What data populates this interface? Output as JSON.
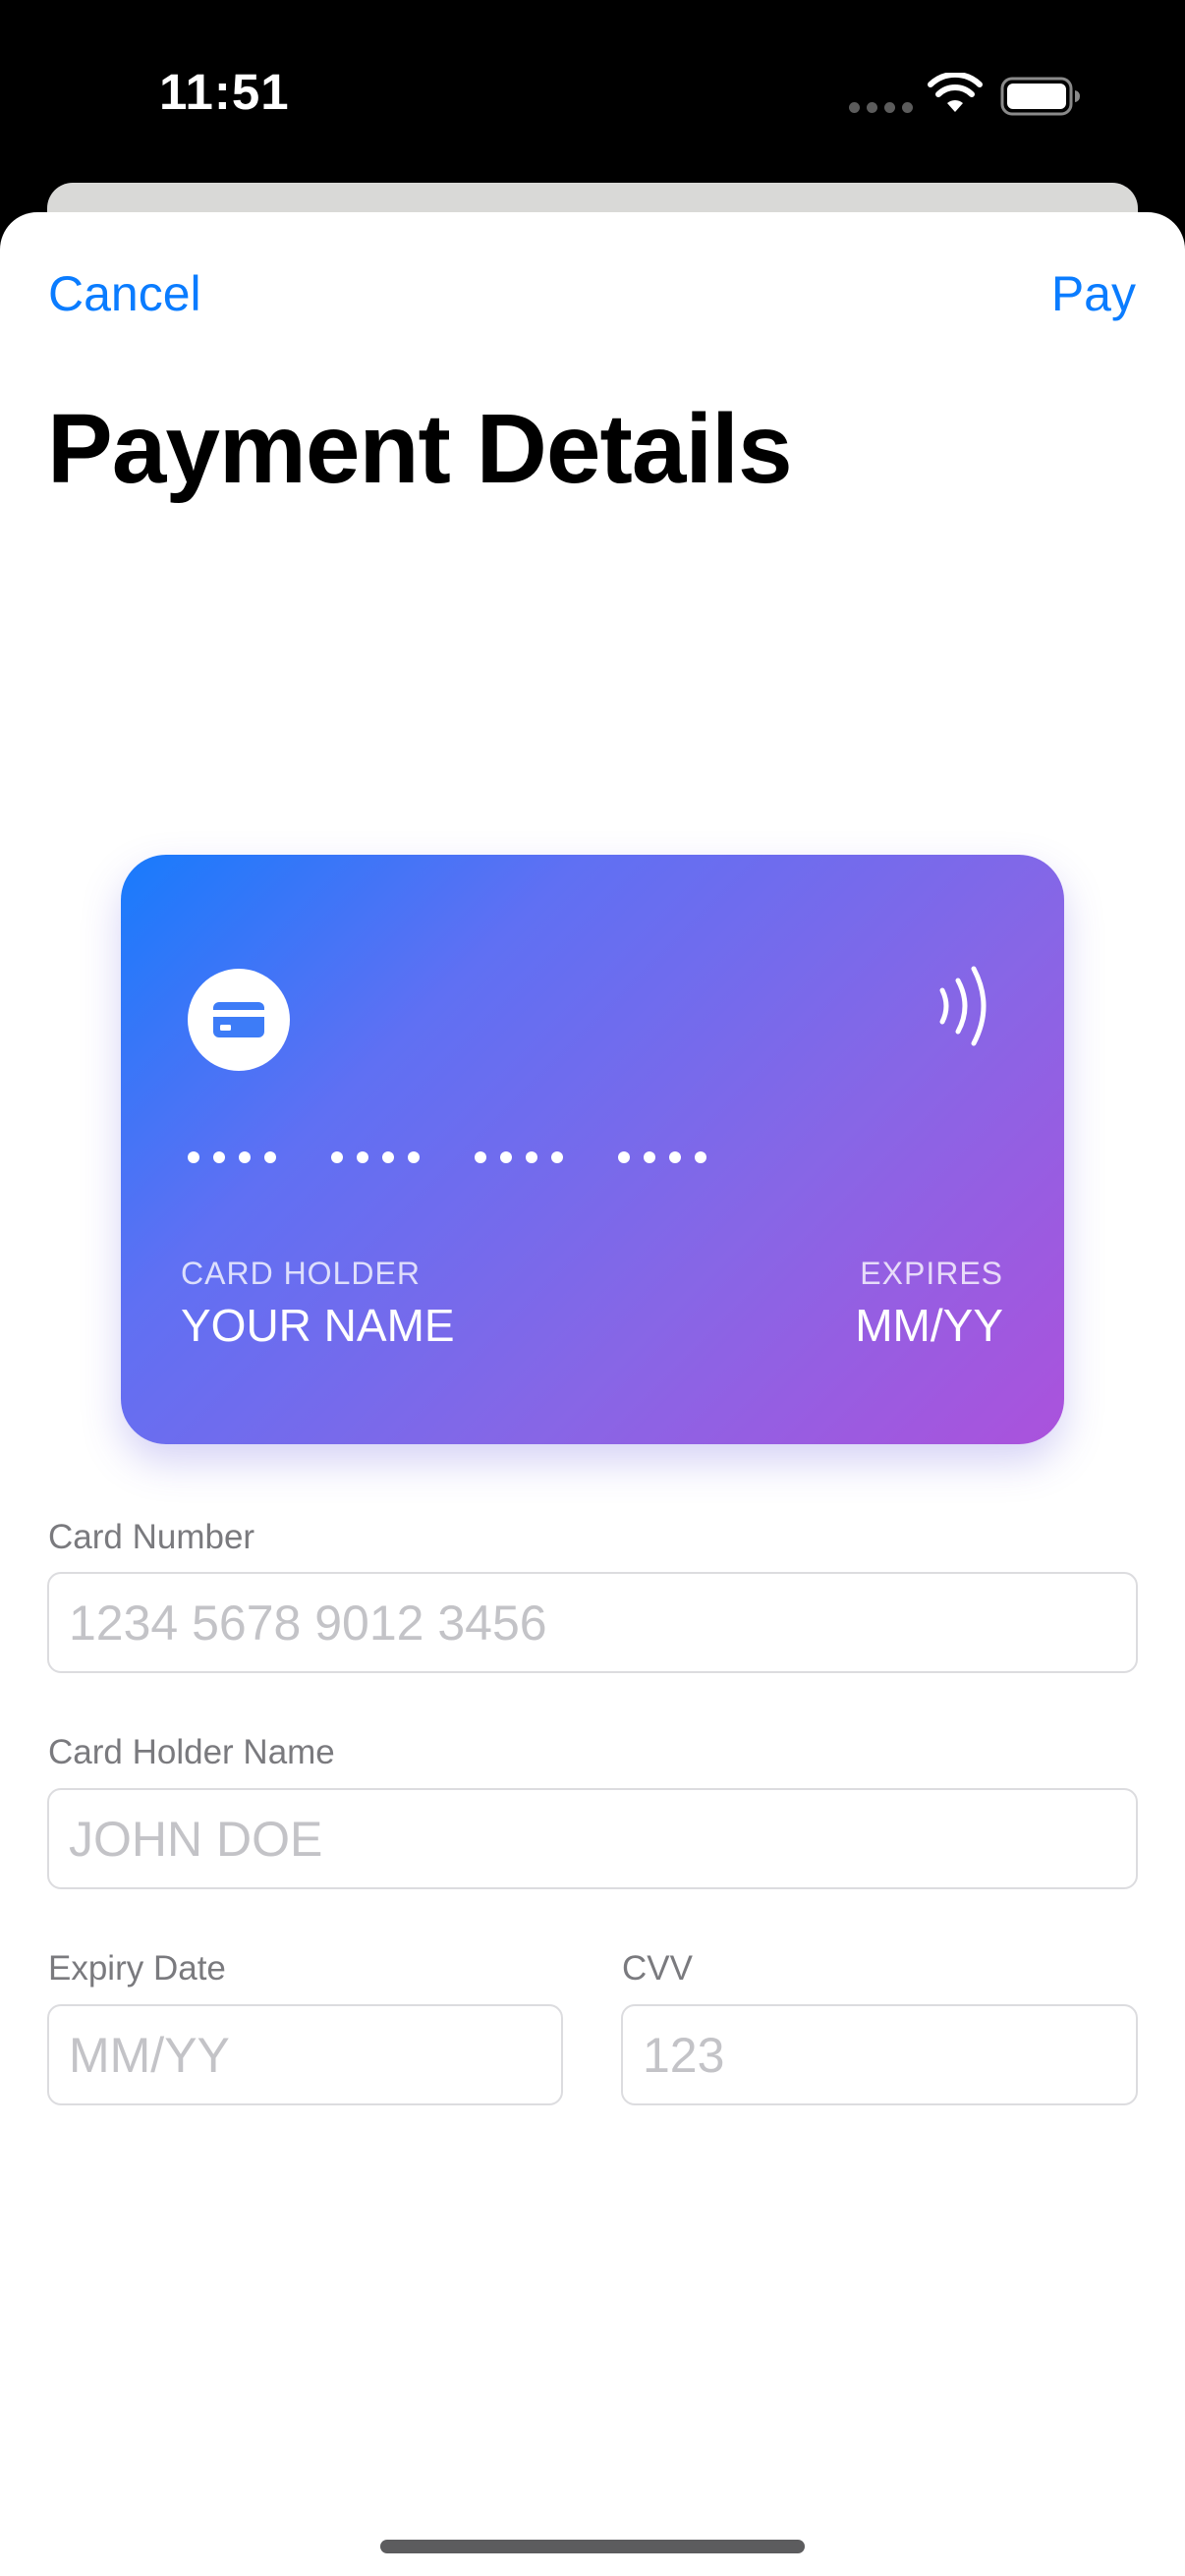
{
  "status_bar": {
    "time": "11:51"
  },
  "nav": {
    "cancel_label": "Cancel",
    "pay_label": "Pay"
  },
  "page": {
    "title": "Payment Details"
  },
  "card_preview": {
    "card_holder_label": "CARD HOLDER",
    "card_holder_value": "YOUR NAME",
    "expires_label": "EXPIRES",
    "expires_value": "MM/YY",
    "icons": [
      "credit-card-icon",
      "contactless-icon"
    ]
  },
  "form": {
    "card_number": {
      "label": "Card Number",
      "placeholder": "1234 5678 9012 3456",
      "value": ""
    },
    "card_holder_name": {
      "label": "Card Holder Name",
      "placeholder": "JOHN DOE",
      "value": ""
    },
    "expiry_date": {
      "label": "Expiry Date",
      "placeholder": "MM/YY",
      "value": ""
    },
    "cvv": {
      "label": "CVV",
      "placeholder": "123",
      "value": ""
    }
  },
  "colors": {
    "accent": "#0a7cff",
    "card_gradient_start": "#187bfc",
    "card_gradient_end": "#ab52dc"
  }
}
